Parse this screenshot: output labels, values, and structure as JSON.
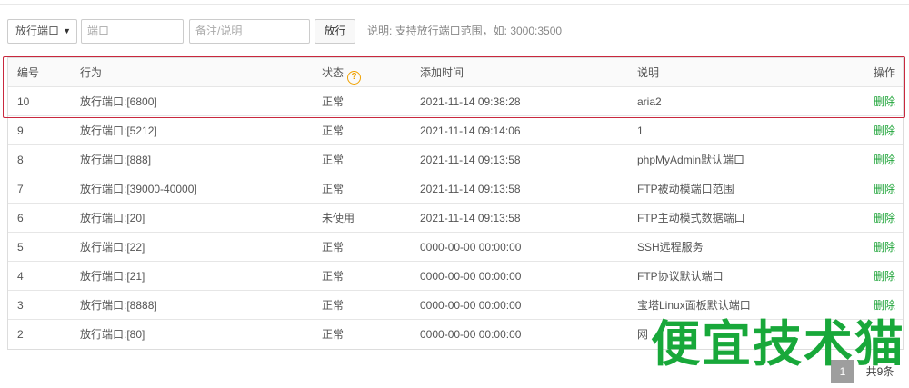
{
  "toolbar": {
    "action_select": "放行端口",
    "port_placeholder": "端口",
    "note_placeholder": "备注/说明",
    "submit_label": "放行",
    "hint": "说明: 支持放行端口范围，如: 3000:3500"
  },
  "table": {
    "headers": {
      "id": "编号",
      "action": "行为",
      "status": "状态",
      "time": "添加时间",
      "note": "说明",
      "op": "操作"
    },
    "rows": [
      {
        "id": "10",
        "action": "放行端口:[6800]",
        "status": "正常",
        "time": "2021-11-14 09:38:28",
        "note": "aria2",
        "op": "删除"
      },
      {
        "id": "9",
        "action": "放行端口:[5212]",
        "status": "正常",
        "time": "2021-11-14 09:14:06",
        "note": "1",
        "op": "删除"
      },
      {
        "id": "8",
        "action": "放行端口:[888]",
        "status": "正常",
        "time": "2021-11-14 09:13:58",
        "note": "phpMyAdmin默认端口",
        "op": "删除"
      },
      {
        "id": "7",
        "action": "放行端口:[39000-40000]",
        "status": "正常",
        "time": "2021-11-14 09:13:58",
        "note": "FTP被动模端口范围",
        "op": "删除"
      },
      {
        "id": "6",
        "action": "放行端口:[20]",
        "status": "未使用",
        "time": "2021-11-14 09:13:58",
        "note": "FTP主动模式数据端口",
        "op": "删除"
      },
      {
        "id": "5",
        "action": "放行端口:[22]",
        "status": "正常",
        "time": "0000-00-00 00:00:00",
        "note": "SSH远程服务",
        "op": "删除"
      },
      {
        "id": "4",
        "action": "放行端口:[21]",
        "status": "正常",
        "time": "0000-00-00 00:00:00",
        "note": "FTP协议默认端口",
        "op": "删除"
      },
      {
        "id": "3",
        "action": "放行端口:[8888]",
        "status": "正常",
        "time": "0000-00-00 00:00:00",
        "note": "宝塔Linux面板默认端口",
        "op": "删除"
      },
      {
        "id": "2",
        "action": "放行端口:[80]",
        "status": "正常",
        "time": "0000-00-00 00:00:00",
        "note": "网",
        "op": ""
      }
    ]
  },
  "pager": {
    "current": "1",
    "total": "共9条"
  },
  "watermark": "便宜技术猫",
  "colors": {
    "accent_green": "#20a53a",
    "highlight_red": "#c9283e",
    "help_orange": "#f0a100"
  }
}
